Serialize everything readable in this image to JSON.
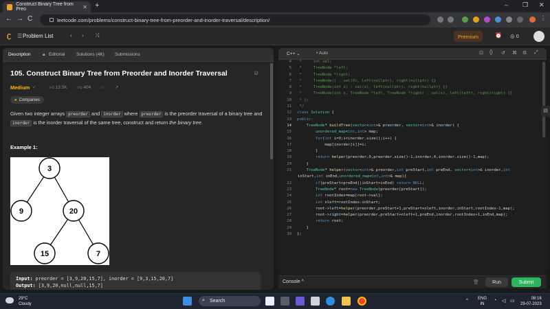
{
  "browser": {
    "tab_title": "Construct Binary Tree from Preo",
    "new_tab": "+",
    "url": "leetcode.com/problems/construct-binary-tree-from-preorder-and-inorder-traversal/description/",
    "back": "←",
    "forward": "→",
    "reload": "C",
    "minimize": "–",
    "maximize": "❐",
    "close": "✕",
    "tab_close": "✕"
  },
  "nav": {
    "problem_list": "Problem List",
    "premium": "Premium",
    "streak": "0"
  },
  "left": {
    "tabs": [
      "Description",
      "Editorial",
      "Solutions (4K)",
      "Submissions"
    ],
    "title": "105. Construct Binary Tree from Preorder and Inorder Traversal",
    "difficulty": "Medium",
    "likes": "13.5K",
    "dislikes": "404",
    "companies": "Companies",
    "desc_parts": {
      "p1": "Given two integer arrays ",
      "c1": "preorder",
      "p2": " and ",
      "c2": "inorder",
      "p3": " where ",
      "c3": "preorder",
      "p4": " is the preorder traversal of a binary tree and ",
      "c4": "inorder",
      "p5": " is the inorder traversal of the same tree, construct and return ",
      "em": "the binary tree",
      "p6": "."
    },
    "example_title": "Example 1:",
    "tree_nodes": [
      "3",
      "9",
      "20",
      "15",
      "7"
    ],
    "input_label": "Input:",
    "input_value": " preorder = [3,9,20,15,7], inorder = [9,3,15,20,7]",
    "output_label": "Output:",
    "output_value": " [3,9,20,null,null,15,7]"
  },
  "editor": {
    "language": "C++",
    "mode": "Auto",
    "console": "Console",
    "run": "Run",
    "submit": "Submit"
  },
  "taskbar": {
    "temp": "29°C",
    "weather": "Cloudy",
    "search": "Search",
    "lang1": "ENG",
    "lang2": "IN",
    "time": "08:16",
    "date": "29-07-2023"
  }
}
